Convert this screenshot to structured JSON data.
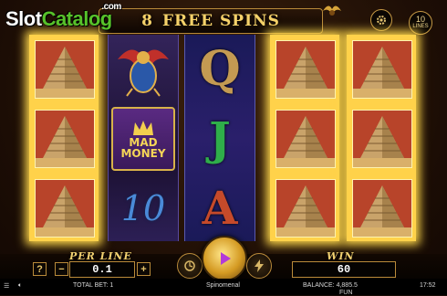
{
  "logo": {
    "slot": "Slot",
    "catalog": "Catalog",
    "com": ".com"
  },
  "header": {
    "count": "8",
    "label": "FREE SPINS"
  },
  "lines_button": {
    "count": "10",
    "label": "LINES"
  },
  "reels": {
    "reel2_symbols": [
      "scarab",
      "MAD MONEY",
      "10"
    ],
    "reel3_symbols": [
      "Q",
      "J",
      "A"
    ],
    "mad_money_text": [
      "MAD",
      "MONEY"
    ],
    "ten_text": "10",
    "q_text": "Q",
    "j_text": "J",
    "a_text": "A"
  },
  "bet": {
    "label": "PER LINE",
    "value": "0.1",
    "minus": "−",
    "plus": "+",
    "info": "?"
  },
  "win": {
    "label": "WIN",
    "value": "60"
  },
  "status": {
    "total_bet": "TOTAL BET: 1",
    "balance": "BALANCE: 4,885.5",
    "mode": "FUN",
    "brand": "Spinomenal",
    "time": "17:52"
  },
  "colors": {
    "gold": "#ffd24a",
    "accent": "#f6d26a",
    "brand_green": "#57c22a"
  }
}
